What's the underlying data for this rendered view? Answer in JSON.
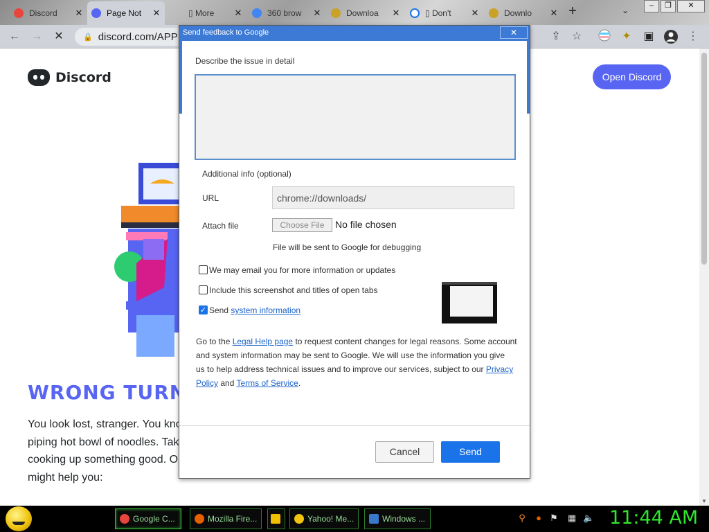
{
  "tabs": [
    {
      "label": "Discord",
      "icon": "chrome-icon",
      "color": "#e8453c",
      "close": "✕"
    },
    {
      "label": "Page Not",
      "icon": "discord-icon",
      "color": "#5865f2",
      "close": "✕"
    },
    {
      "label": "▯ More",
      "icon": "",
      "color": "",
      "close": "✕"
    },
    {
      "label": "360 brow",
      "icon": "google-icon",
      "color": "#4285f4",
      "close": "✕"
    },
    {
      "label": "Downloa",
      "icon": "download-icon",
      "color": "#c9a227",
      "close": "✕"
    },
    {
      "label": "▯ Don't",
      "icon": "loading-icon",
      "color": "#1a73e8",
      "close": "✕"
    },
    {
      "label": "Downlo",
      "icon": "download-icon",
      "color": "#c9a227",
      "close": "✕"
    }
  ],
  "toolbar": {
    "url": "discord.com/APP"
  },
  "page": {
    "brand": "Discord",
    "open_button": "Open Discord",
    "heading": "WRONG TURN",
    "lost_lines": [
      "You look lost, stranger. You know what helps",
      "piping hot bowl of noodles. Take a seat, we're",
      "cooking up something good. Or check out these links",
      "might help you:"
    ]
  },
  "dialog": {
    "title": "Send feedback to Google",
    "close": "✕",
    "describe_label": "Describe the issue in detail",
    "additional_label": "Additional info (optional)",
    "url_label": "URL",
    "url_value": "chrome://downloads/",
    "attach_label": "Attach file",
    "choose_file": "Choose File",
    "no_file": "No file chosen",
    "debug_note": "File will be sent to Google for debugging",
    "email_opt": "We may email you for more information or updates",
    "screenshot_opt": "Include this screenshot and titles of open tabs",
    "sysinfo_prefix": "Send ",
    "sysinfo_link": "system information",
    "legal": {
      "l1_a": "Go to the ",
      "l1_link": "Legal Help page",
      "l1_b": " to request content changes for legal reasons. Some account",
      "l2": "and system information may be sent to Google. We will use the information you give",
      "l3_a": "us to help address technical issues and to improve our services, subject to our ",
      "l3_link": "Privacy",
      "l4_link1": "Policy",
      "l4_mid": " and ",
      "l4_link2": "Terms of Service",
      "l4_end": "."
    },
    "cancel": "Cancel",
    "send": "Send"
  },
  "taskbar": {
    "buttons": [
      {
        "label": "Google C...",
        "color": "#e8453c",
        "active": true
      },
      {
        "label": "Mozilla Fire...",
        "color": "#e66000",
        "active": false
      },
      {
        "label": "",
        "color": "#f0c000",
        "active": false
      },
      {
        "label": "Yahoo! Me...",
        "color": "#f1c40f",
        "active": false
      },
      {
        "label": "Windows ...",
        "color": "#3a78c9",
        "active": false
      }
    ],
    "clock": "11:44 AM"
  }
}
